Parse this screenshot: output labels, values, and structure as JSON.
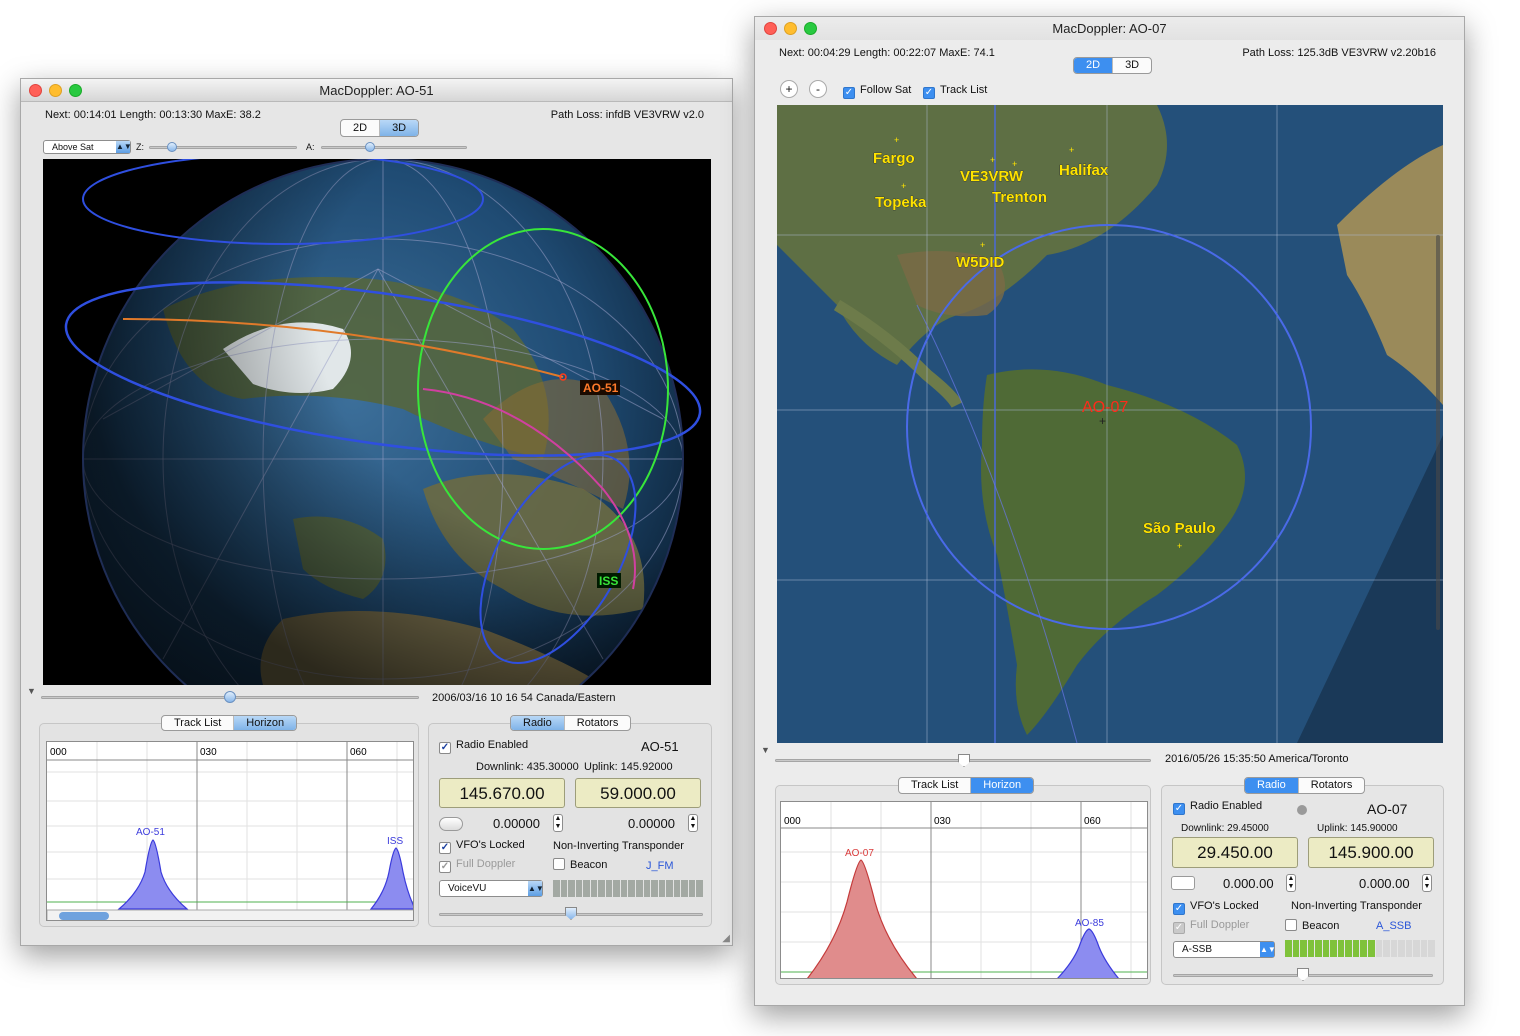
{
  "left_window": {
    "title": "MacDoppler: AO-51",
    "info_left": "Next: 00:14:01 Length: 00:13:30 MaxE: 38.2",
    "info_right": "Path Loss: infdB VE3VRW v2.0",
    "view_tabs": [
      "2D",
      "3D"
    ],
    "selected_view": "3D",
    "view_mode_select": "Above Sat",
    "z_label": "Z:",
    "a_label": "A:",
    "globe_labels": [
      "AO-51",
      "ISS"
    ],
    "timeline": "2006/03/16 10 16 54 Canada/Eastern",
    "bottom_tabs": [
      "Track List",
      "Horizon"
    ],
    "selected_bottom_tab": "Horizon",
    "horizon": {
      "ticks": [
        "000",
        "030",
        "060"
      ],
      "passes": [
        {
          "name": "AO-51",
          "color": "#3b3bdc"
        },
        {
          "name": "ISS",
          "color": "#3b3bdc"
        }
      ]
    },
    "radio_tabs": [
      "Radio",
      "Rotators"
    ],
    "selected_radio_tab": "Radio",
    "radio": {
      "radio_enabled_label": "Radio Enabled",
      "sat_name": "AO-51",
      "downlink_label": "Downlink: 435.30000",
      "uplink_label": "Uplink: 145.92000",
      "downlink_freq": "145.670.00",
      "uplink_freq": "59.000.00",
      "rit_left": "0.00000",
      "rit_right": "0.00000",
      "vfo_locked_label": "VFO's Locked",
      "full_doppler_label": "Full Doppler",
      "transponder_label": "Non-Inverting Transponder",
      "beacon_label": "Beacon",
      "mode": "J_FM",
      "voice_select": "VoiceVU"
    }
  },
  "right_window": {
    "title": "MacDoppler: AO-07",
    "info_left": "Next: 00:04:29 Length: 00:22:07 MaxE: 74.1",
    "info_right": "Path Loss: 125.3dB VE3VRW v2.20b16",
    "view_tabs": [
      "2D",
      "3D"
    ],
    "selected_view": "2D",
    "zoom_in": "+",
    "zoom_out": "-",
    "follow_sat_label": "Follow Sat",
    "track_list_label": "Track List",
    "map_labels": {
      "fargo": "Fargo",
      "topeka": "Topeka",
      "ve3vrw": "VE3VRW",
      "trenton": "Trenton",
      "halifax": "Halifax",
      "w5did": "W5DID",
      "ao07": "AO-07",
      "sao_paulo": "São Paulo"
    },
    "timeline": "2016/05/26 15:35:50 America/Toronto",
    "bottom_tabs": [
      "Track List",
      "Horizon"
    ],
    "selected_bottom_tab": "Horizon",
    "horizon": {
      "ticks": [
        "000",
        "030",
        "060"
      ],
      "passes": [
        {
          "name": "AO-07",
          "color": "#d93a3a"
        },
        {
          "name": "AO-85",
          "color": "#3b3bdc"
        }
      ]
    },
    "radio_tabs": [
      "Radio",
      "Rotators"
    ],
    "selected_radio_tab": "Radio",
    "radio": {
      "radio_enabled_label": "Radio Enabled",
      "sat_name": "AO-07",
      "downlink_label": "Downlink: 29.45000",
      "uplink_label": "Uplink: 145.90000",
      "downlink_freq": "29.450.00",
      "uplink_freq": "145.900.00",
      "rit_left": "0.000.00",
      "rit_right": "0.000.00",
      "vfo_locked_label": "VFO's Locked",
      "full_doppler_label": "Full Doppler",
      "transponder_label": "Non-Inverting Transponder",
      "beacon_label": "Beacon",
      "mode": "A_SSB",
      "mode_select": "A-SSB"
    }
  }
}
